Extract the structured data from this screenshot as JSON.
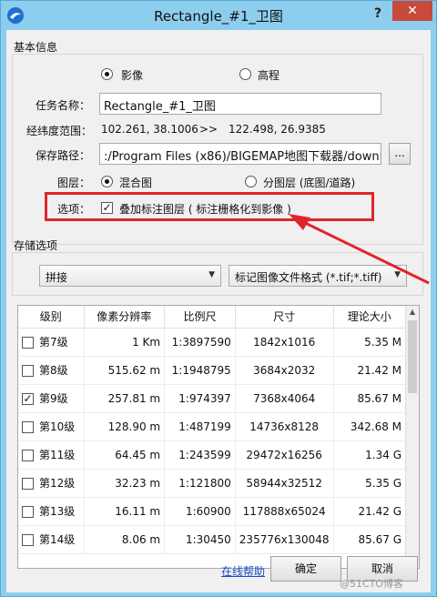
{
  "window": {
    "title": "Rectangle_#1_卫图",
    "help_label": "?",
    "close_label": "✕"
  },
  "basic": {
    "legend": "基本信息",
    "radio_image": "影像",
    "radio_elevation": "高程",
    "task_label": "任务名称：",
    "task_value": "Rectangle_#1_卫图",
    "range_label": "经纬度范围：",
    "range_from": "102.261, 38.1006",
    "range_arrow": ">>",
    "range_to": "122.498, 26.9385",
    "path_label": "保存路径：",
    "path_value": ":/Program Files (x86)/BIGEMAP地图下载器/download",
    "browse_label": "...",
    "layer_label": "图层：",
    "layer_mixed": "混合图",
    "layer_split": "分图层 (底图/道路)",
    "option_label": "选项：",
    "option_overlay": "叠加标注图层 ( 标注栅格化到影像 )"
  },
  "storage": {
    "legend": "存储选项",
    "mode": "拼接",
    "format": "标记图像文件格式 (*.tif;*.tiff)"
  },
  "table": {
    "headers": [
      "级别",
      "像素分辨率",
      "比例尺",
      "尺寸",
      "理论大小"
    ],
    "rows": [
      {
        "level": "第7级",
        "res": "1 Km",
        "scale": "1:3897590",
        "size": "1842x1016",
        "est": "5.35 M",
        "checked": false
      },
      {
        "level": "第8级",
        "res": "515.62  m",
        "scale": "1:1948795",
        "size": "3684x2032",
        "est": "21.42 M",
        "checked": false
      },
      {
        "level": "第9级",
        "res": "257.81  m",
        "scale": "1:974397",
        "size": "7368x4064",
        "est": "85.67 M",
        "checked": true
      },
      {
        "level": "第10级",
        "res": "128.90  m",
        "scale": "1:487199",
        "size": "14736x8128",
        "est": "342.68 M",
        "checked": false
      },
      {
        "level": "第11级",
        "res": "64.45  m",
        "scale": "1:243599",
        "size": "29472x16256",
        "est": "1.34 G",
        "checked": false
      },
      {
        "level": "第12级",
        "res": "32.23  m",
        "scale": "1:121800",
        "size": "58944x32512",
        "est": "5.35 G",
        "checked": false
      },
      {
        "level": "第13级",
        "res": "16.11  m",
        "scale": "1:60900",
        "size": "117888x65024",
        "est": "21.42 G",
        "checked": false
      },
      {
        "level": "第14级",
        "res": "8.06  m",
        "scale": "1:30450",
        "size": "235776x130048",
        "est": "85.67 G",
        "checked": false
      }
    ]
  },
  "footer": {
    "help_link": "在线帮助",
    "ok_label": "确定",
    "cancel_label": "取消",
    "watermark": "@51CTO博客"
  },
  "colors": {
    "annotation_red": "#e0252b",
    "titlebar": "#8dcdee"
  }
}
